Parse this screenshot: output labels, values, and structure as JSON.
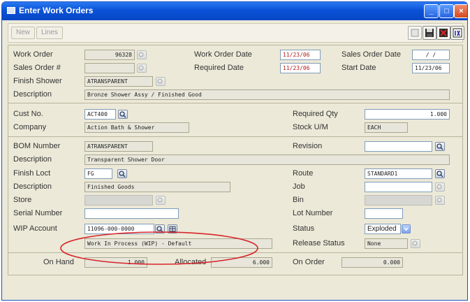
{
  "window": {
    "title": "Enter Work Orders"
  },
  "toolbar": {
    "new_label": "New",
    "lines_label": "Lines"
  },
  "form": {
    "work_order_label": "Work Order",
    "work_order_value": "96328",
    "work_order_date_label": "Work Order Date",
    "work_order_date_value": "11/23/06",
    "sales_order_date_label": "Sales Order Date",
    "sales_order_date_value": "/ /",
    "sales_order_no_label": "Sales Order #",
    "sales_order_no_value": "",
    "required_date_label": "Required Date",
    "required_date_value": "11/23/06",
    "start_date_label": "Start Date",
    "start_date_value": "11/23/06",
    "finish_shower_label": "Finish Shower",
    "finish_shower_value": "ATRANSPARENT",
    "description_label": "Description",
    "description_value": "Bronze Shower Assy / Finished Good",
    "cust_no_label": "Cust No.",
    "cust_no_value": "ACT400",
    "required_qty_label": "Required Qty",
    "required_qty_value": "1.000",
    "company_label": "Company",
    "company_value": "Action Bath & Shower",
    "stock_um_label": "Stock U/M",
    "stock_um_value": "EACH",
    "bom_number_label": "BOM Number",
    "bom_number_value": "ATRANSPARENT",
    "revision_label": "Revision",
    "revision_value": "",
    "bom_description_label": "Description",
    "bom_description_value": "Transparent Shower Door",
    "finish_loct_label": "Finish Loct",
    "finish_loct_value": "FG",
    "route_label": "Route",
    "route_value": "STANDARD1",
    "loct_description_label": "Description",
    "loct_description_value": "Finished Goods",
    "job_label": "Job",
    "job_value": "",
    "store_label": "Store",
    "store_value": "",
    "bin_label": "Bin",
    "bin_value": "",
    "serial_number_label": "Serial Number",
    "serial_number_value": "",
    "lot_number_label": "Lot Number",
    "lot_number_value": "",
    "wip_account_label": "WIP Account",
    "wip_account_value": "11096-000-0000",
    "status_label": "Status",
    "status_value": "Exploded",
    "wip_description_value": "Work In Process (WIP) - Default",
    "release_status_label": "Release Status",
    "release_status_value": "None"
  },
  "totals": {
    "on_hand_label": "On Hand",
    "on_hand_value": "1.000",
    "allocated_label": "Allocated",
    "allocated_value": "6.000",
    "on_order_label": "On Order",
    "on_order_value": "0.000"
  },
  "colors": {
    "title_bar": "#0a52d8",
    "date_text": "#b01818",
    "highlight_ellipse": "#d8242a"
  }
}
